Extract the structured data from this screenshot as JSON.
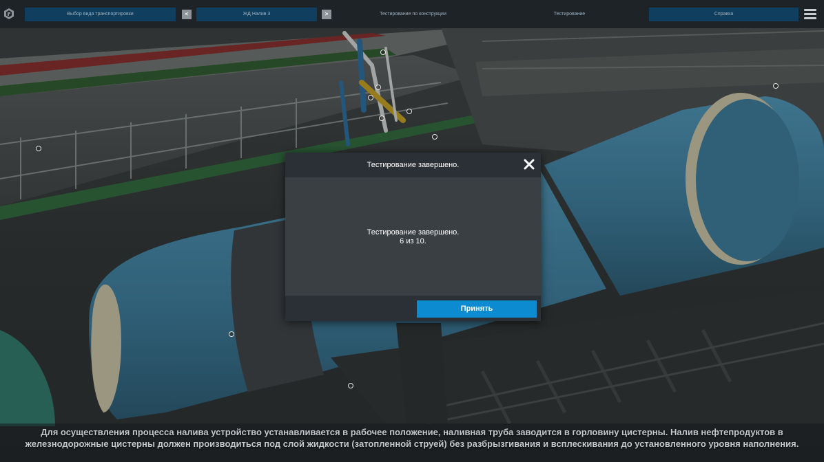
{
  "toolbar": {
    "transport_select_label": "Выбор вида транспортировки",
    "prev_label": "<",
    "scenario_label": "ЖД Налив 3",
    "next_label": ">",
    "construction_test_label": "Тестирование по конструкции",
    "testing_label": "Тестирование",
    "help_label": "Справка",
    "logo_icon": "app-logo-icon",
    "menu_icon": "hamburger-menu-icon"
  },
  "dialog": {
    "title": "Тестирование завершено.",
    "message": "Тестирование завершено.",
    "score": "6 из 10.",
    "accept_label": "Принять",
    "close_icon": "close-icon"
  },
  "caption": {
    "text": "Для осуществления процесса налива устройство устанавливается в рабочее положение, наливная труба заводится в горловину цистерны. Налив нефтепродуктов в железнодорожные цистерны должен производиться под слой жидкости (затопленной струей) без разбрызгивания и всплескивания до установленного уровня наполнения."
  },
  "colors": {
    "toolbar_bg": "#1e2328",
    "toolbar_button": "#0f3e5e",
    "accent": "#0c8bd0",
    "dialog_bg": "#3a3f44",
    "dialog_header": "#2b3036",
    "tank_blue": "#3f86a8"
  }
}
